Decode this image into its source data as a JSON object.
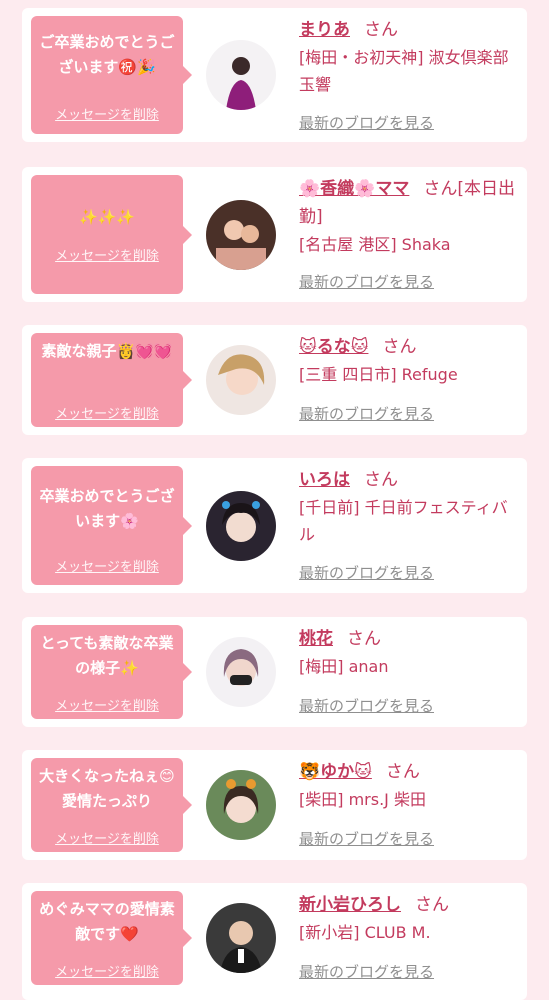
{
  "delete_label": "メッセージを削除",
  "blog_label": "最新のブログを見る",
  "san_label": "さん",
  "colors": {
    "page_bg": "#fdebef",
    "bubble": "#f59aaa",
    "name": "#c33b5e",
    "link": "#8f8f8f"
  },
  "entries": [
    {
      "message": "ご卒業おめでとうございます㊗️🎉",
      "name": "まりあ",
      "name_suffix": "",
      "shop": "[梅田・お初天神] 淑女倶楽部 玉響",
      "avatar_icon": "profile-photo"
    },
    {
      "message": "✨✨✨",
      "name": "🌸香織🌸ママ",
      "name_suffix": "[本日出勤]",
      "shop": "[名古屋 港区] Shaka",
      "avatar_icon": "profile-photo"
    },
    {
      "message": "素敵な親子👸💓💓",
      "name": "🐱るな🐱",
      "name_suffix": "",
      "shop": "[三重 四日市] Refuge",
      "avatar_icon": "profile-photo"
    },
    {
      "message": "卒業おめでとうございます🌸",
      "name": "いろは",
      "name_suffix": "",
      "shop": "[千日前] 千日前フェスティバル",
      "avatar_icon": "profile-photo"
    },
    {
      "message": "とっても素敵な卒業の様子✨",
      "name": "桃花",
      "name_suffix": "",
      "shop": "[梅田] anan",
      "avatar_icon": "profile-photo"
    },
    {
      "message": "大きくなったねぇ😊愛情たっぷり",
      "name": "🐯ゆか🐱",
      "name_suffix": "",
      "shop": "[柴田] mrs.J 柴田",
      "avatar_icon": "profile-photo"
    },
    {
      "message": "めぐみママの愛情素敵です❤️",
      "name": "新小岩ひろし",
      "name_suffix": "",
      "shop": "[新小岩] CLUB M.",
      "avatar_icon": "profile-photo"
    }
  ]
}
